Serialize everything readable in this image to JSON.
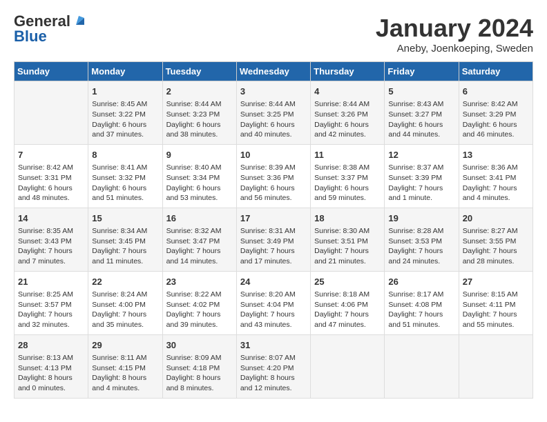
{
  "header": {
    "logo_general": "General",
    "logo_blue": "Blue",
    "month_title": "January 2024",
    "subtitle": "Aneby, Joenkoeping, Sweden"
  },
  "weekdays": [
    "Sunday",
    "Monday",
    "Tuesday",
    "Wednesday",
    "Thursday",
    "Friday",
    "Saturday"
  ],
  "weeks": [
    [
      {
        "day": "",
        "sunrise": "",
        "sunset": "",
        "daylight": ""
      },
      {
        "day": "1",
        "sunrise": "Sunrise: 8:45 AM",
        "sunset": "Sunset: 3:22 PM",
        "daylight": "Daylight: 6 hours and 37 minutes."
      },
      {
        "day": "2",
        "sunrise": "Sunrise: 8:44 AM",
        "sunset": "Sunset: 3:23 PM",
        "daylight": "Daylight: 6 hours and 38 minutes."
      },
      {
        "day": "3",
        "sunrise": "Sunrise: 8:44 AM",
        "sunset": "Sunset: 3:25 PM",
        "daylight": "Daylight: 6 hours and 40 minutes."
      },
      {
        "day": "4",
        "sunrise": "Sunrise: 8:44 AM",
        "sunset": "Sunset: 3:26 PM",
        "daylight": "Daylight: 6 hours and 42 minutes."
      },
      {
        "day": "5",
        "sunrise": "Sunrise: 8:43 AM",
        "sunset": "Sunset: 3:27 PM",
        "daylight": "Daylight: 6 hours and 44 minutes."
      },
      {
        "day": "6",
        "sunrise": "Sunrise: 8:42 AM",
        "sunset": "Sunset: 3:29 PM",
        "daylight": "Daylight: 6 hours and 46 minutes."
      }
    ],
    [
      {
        "day": "7",
        "sunrise": "Sunrise: 8:42 AM",
        "sunset": "Sunset: 3:31 PM",
        "daylight": "Daylight: 6 hours and 48 minutes."
      },
      {
        "day": "8",
        "sunrise": "Sunrise: 8:41 AM",
        "sunset": "Sunset: 3:32 PM",
        "daylight": "Daylight: 6 hours and 51 minutes."
      },
      {
        "day": "9",
        "sunrise": "Sunrise: 8:40 AM",
        "sunset": "Sunset: 3:34 PM",
        "daylight": "Daylight: 6 hours and 53 minutes."
      },
      {
        "day": "10",
        "sunrise": "Sunrise: 8:39 AM",
        "sunset": "Sunset: 3:36 PM",
        "daylight": "Daylight: 6 hours and 56 minutes."
      },
      {
        "day": "11",
        "sunrise": "Sunrise: 8:38 AM",
        "sunset": "Sunset: 3:37 PM",
        "daylight": "Daylight: 6 hours and 59 minutes."
      },
      {
        "day": "12",
        "sunrise": "Sunrise: 8:37 AM",
        "sunset": "Sunset: 3:39 PM",
        "daylight": "Daylight: 7 hours and 1 minute."
      },
      {
        "day": "13",
        "sunrise": "Sunrise: 8:36 AM",
        "sunset": "Sunset: 3:41 PM",
        "daylight": "Daylight: 7 hours and 4 minutes."
      }
    ],
    [
      {
        "day": "14",
        "sunrise": "Sunrise: 8:35 AM",
        "sunset": "Sunset: 3:43 PM",
        "daylight": "Daylight: 7 hours and 7 minutes."
      },
      {
        "day": "15",
        "sunrise": "Sunrise: 8:34 AM",
        "sunset": "Sunset: 3:45 PM",
        "daylight": "Daylight: 7 hours and 11 minutes."
      },
      {
        "day": "16",
        "sunrise": "Sunrise: 8:32 AM",
        "sunset": "Sunset: 3:47 PM",
        "daylight": "Daylight: 7 hours and 14 minutes."
      },
      {
        "day": "17",
        "sunrise": "Sunrise: 8:31 AM",
        "sunset": "Sunset: 3:49 PM",
        "daylight": "Daylight: 7 hours and 17 minutes."
      },
      {
        "day": "18",
        "sunrise": "Sunrise: 8:30 AM",
        "sunset": "Sunset: 3:51 PM",
        "daylight": "Daylight: 7 hours and 21 minutes."
      },
      {
        "day": "19",
        "sunrise": "Sunrise: 8:28 AM",
        "sunset": "Sunset: 3:53 PM",
        "daylight": "Daylight: 7 hours and 24 minutes."
      },
      {
        "day": "20",
        "sunrise": "Sunrise: 8:27 AM",
        "sunset": "Sunset: 3:55 PM",
        "daylight": "Daylight: 7 hours and 28 minutes."
      }
    ],
    [
      {
        "day": "21",
        "sunrise": "Sunrise: 8:25 AM",
        "sunset": "Sunset: 3:57 PM",
        "daylight": "Daylight: 7 hours and 32 minutes."
      },
      {
        "day": "22",
        "sunrise": "Sunrise: 8:24 AM",
        "sunset": "Sunset: 4:00 PM",
        "daylight": "Daylight: 7 hours and 35 minutes."
      },
      {
        "day": "23",
        "sunrise": "Sunrise: 8:22 AM",
        "sunset": "Sunset: 4:02 PM",
        "daylight": "Daylight: 7 hours and 39 minutes."
      },
      {
        "day": "24",
        "sunrise": "Sunrise: 8:20 AM",
        "sunset": "Sunset: 4:04 PM",
        "daylight": "Daylight: 7 hours and 43 minutes."
      },
      {
        "day": "25",
        "sunrise": "Sunrise: 8:18 AM",
        "sunset": "Sunset: 4:06 PM",
        "daylight": "Daylight: 7 hours and 47 minutes."
      },
      {
        "day": "26",
        "sunrise": "Sunrise: 8:17 AM",
        "sunset": "Sunset: 4:08 PM",
        "daylight": "Daylight: 7 hours and 51 minutes."
      },
      {
        "day": "27",
        "sunrise": "Sunrise: 8:15 AM",
        "sunset": "Sunset: 4:11 PM",
        "daylight": "Daylight: 7 hours and 55 minutes."
      }
    ],
    [
      {
        "day": "28",
        "sunrise": "Sunrise: 8:13 AM",
        "sunset": "Sunset: 4:13 PM",
        "daylight": "Daylight: 8 hours and 0 minutes."
      },
      {
        "day": "29",
        "sunrise": "Sunrise: 8:11 AM",
        "sunset": "Sunset: 4:15 PM",
        "daylight": "Daylight: 8 hours and 4 minutes."
      },
      {
        "day": "30",
        "sunrise": "Sunrise: 8:09 AM",
        "sunset": "Sunset: 4:18 PM",
        "daylight": "Daylight: 8 hours and 8 minutes."
      },
      {
        "day": "31",
        "sunrise": "Sunrise: 8:07 AM",
        "sunset": "Sunset: 4:20 PM",
        "daylight": "Daylight: 8 hours and 12 minutes."
      },
      {
        "day": "",
        "sunrise": "",
        "sunset": "",
        "daylight": ""
      },
      {
        "day": "",
        "sunrise": "",
        "sunset": "",
        "daylight": ""
      },
      {
        "day": "",
        "sunrise": "",
        "sunset": "",
        "daylight": ""
      }
    ]
  ]
}
